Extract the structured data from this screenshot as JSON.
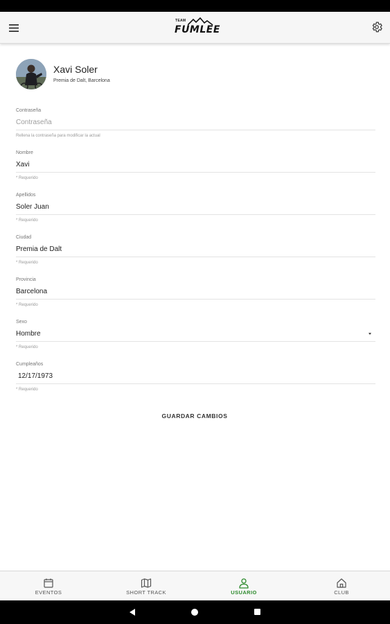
{
  "app": {
    "logo_small": "TEAM",
    "logo_main": "FUMLEE"
  },
  "profile": {
    "name": "Xavi Soler",
    "location": "Premia de Dalt, Barcelona"
  },
  "form": {
    "password": {
      "label": "Contraseña",
      "placeholder": "Contraseña",
      "value": "",
      "hint": "Rellena la contraseña para modificar la actual"
    },
    "nombre": {
      "label": "Nombre",
      "value": "Xavi",
      "hint": "* Requerido"
    },
    "apellidos": {
      "label": "Apellidos",
      "value": "Soler Juan",
      "hint": "* Requerido"
    },
    "ciudad": {
      "label": "Ciudad",
      "value": "Premia de Dalt",
      "hint": "* Requerido"
    },
    "provincia": {
      "label": "Provincia",
      "value": "Barcelona",
      "hint": "* Requerido"
    },
    "sexo": {
      "label": "Sexo",
      "value": "Hombre",
      "hint": "* Requerido"
    },
    "cumpleanos": {
      "label": "Cumpleaños",
      "value": "12/17/1973",
      "hint": "* Requerido"
    },
    "save_label": "GUARDAR CAMBIOS"
  },
  "bottom_nav": {
    "items": [
      {
        "label": "EVENTOS",
        "icon": "calendar-icon"
      },
      {
        "label": "SHORT TRACK",
        "icon": "map-icon"
      },
      {
        "label": "USUARIO",
        "icon": "user-icon",
        "active": true
      },
      {
        "label": "CLUB",
        "icon": "home-icon"
      }
    ]
  },
  "colors": {
    "accent_active": "#2e8b2e",
    "app_bar": "#f6f6f6",
    "nav_bar": "#f7f7f7"
  }
}
